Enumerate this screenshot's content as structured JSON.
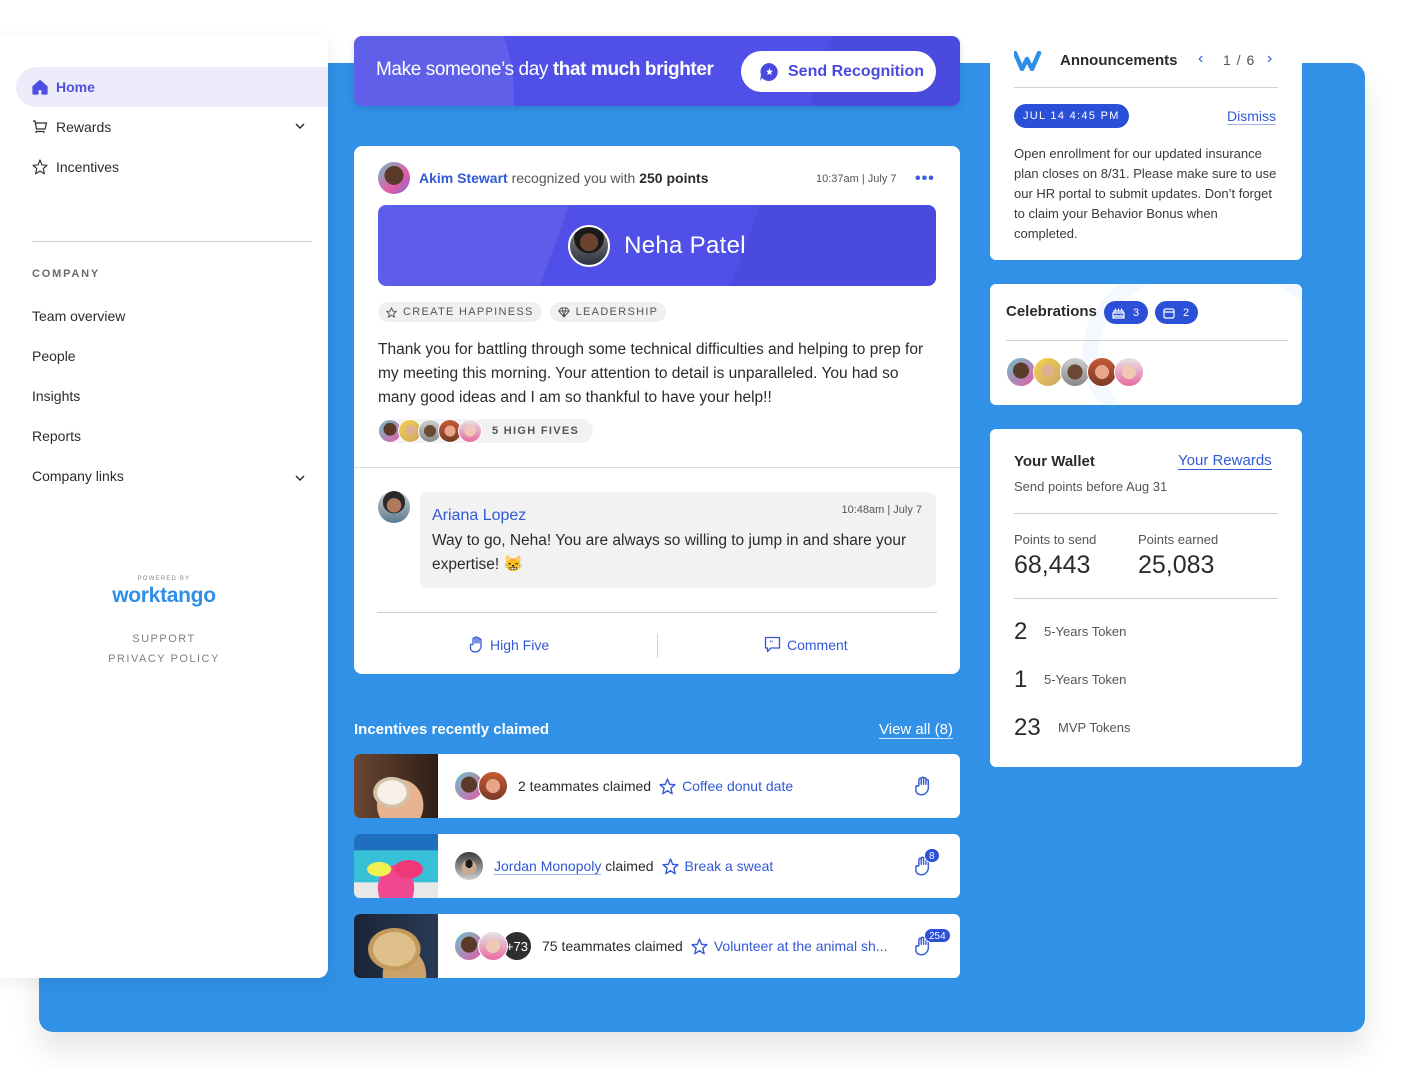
{
  "sidebar": {
    "nav": [
      {
        "label": "Home",
        "icon": "home-icon",
        "active": true
      },
      {
        "label": "Rewards",
        "icon": "cart-icon",
        "expandable": true
      },
      {
        "label": "Incentives",
        "icon": "star-icon"
      }
    ],
    "section_title": "COMPANY",
    "company_items": [
      {
        "label": "Team overview"
      },
      {
        "label": "People"
      },
      {
        "label": "Insights"
      },
      {
        "label": "Reports"
      },
      {
        "label": "Company links",
        "expandable": true
      }
    ],
    "powered_by": "POWERED BY",
    "brand": "worktango",
    "support": "SUPPORT",
    "privacy": "PRIVACY POLICY"
  },
  "banner": {
    "text_regular": "Make someone’s day ",
    "text_bold": "that much brighter",
    "button_label": "Send Recognition"
  },
  "recognition": {
    "sender": "Akim Stewart",
    "action_text": " recognized you with ",
    "points": "250 points",
    "time": "10:37am | July 7",
    "recipient": "Neha Patel",
    "tags": [
      "CREATE HAPPINESS",
      "LEADERSHIP"
    ],
    "message": "Thank you for battling through some technical difficulties and helping to prep for my meeting this morning. Your attention to detail is unparalleled. You had so many good ideas and I am so thankful to have your help!!",
    "high_fives_label": "5 HIGH FIVES",
    "comment": {
      "author": "Ariana Lopez",
      "time": "10:48am | July 7",
      "text": "Way to go, Neha! You are always so willing to jump in and share your expertise! 😸"
    },
    "actions": {
      "high_five": "High Five",
      "comment": "Comment"
    }
  },
  "incentives": {
    "title": "Incentives recently claimed",
    "view_all": "View all (8)",
    "rows": [
      {
        "claimer_text": "2 teammates claimed",
        "claimer_link": "",
        "incentive": "Coffee donut date",
        "high_fives": null
      },
      {
        "claimer_text": " claimed",
        "claimer_link": "Jordan Monopoly",
        "incentive": "Break a sweat",
        "high_fives": "8"
      },
      {
        "claimer_text": "75 teammates claimed",
        "claimer_link": "",
        "extra_count": "+73",
        "incentive": "Volunteer at the animal sh...",
        "high_fives": "254"
      }
    ]
  },
  "announcements": {
    "title": "Announcements",
    "page": "1 / 6",
    "date": "JUL 14 4:45 PM",
    "dismiss": "Dismiss",
    "text": "Open enrollment for our updated insurance plan closes on 8/31.  Please make sure to use our HR portal to submit updates. Don’t forget to claim your Behavior Bonus when completed."
  },
  "celebrations": {
    "title": "Celebrations",
    "birthdays": "3",
    "anniversaries": "2"
  },
  "wallet": {
    "title": "Your Wallet",
    "rewards_link": "Your Rewards",
    "subtitle": "Send points before Aug 31",
    "points_to_send_label": "Points to send",
    "points_to_send": "68,443",
    "points_earned_label": "Points earned",
    "points_earned": "25,083",
    "tokens": [
      {
        "count": "2",
        "label": "5-Years Token"
      },
      {
        "count": "1",
        "label": "5-Years Token"
      },
      {
        "count": "23",
        "label": "MVP Tokens"
      }
    ]
  },
  "colors": {
    "background_blue": "#3091e7",
    "accent_purple": "#5050e8",
    "link_blue": "#3259d6",
    "badge_blue": "#2b4fd6"
  }
}
